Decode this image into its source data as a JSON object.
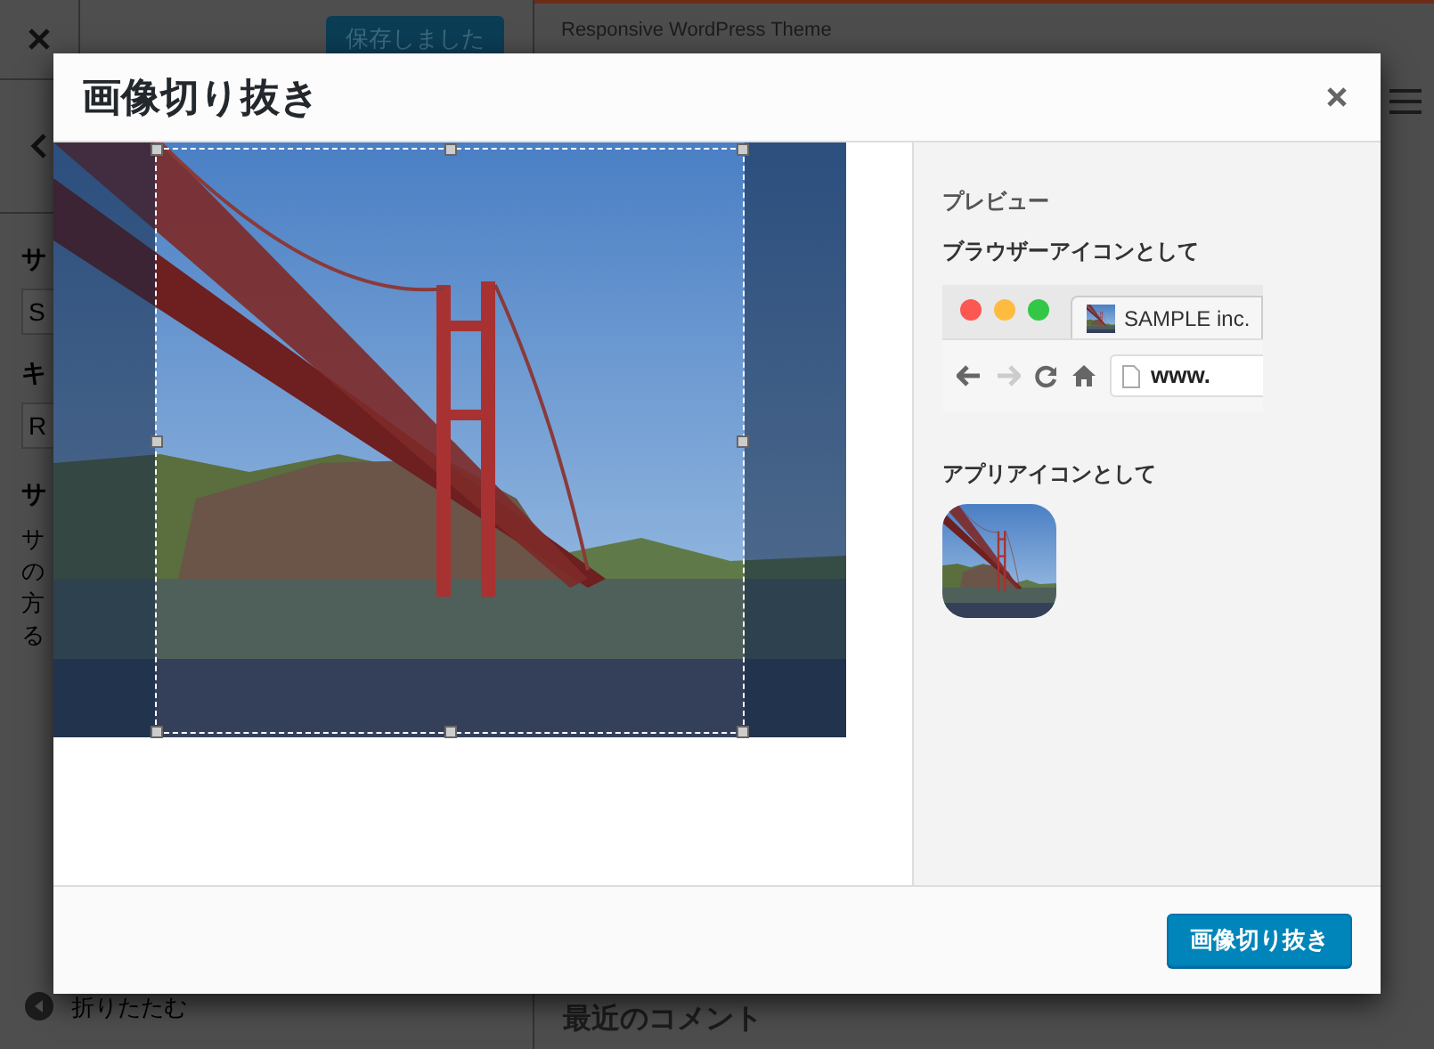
{
  "sidebar": {
    "save_button": "保存しました",
    "fields": [
      {
        "label": "サ",
        "value": "S"
      },
      {
        "label": "キ",
        "value": "R"
      }
    ],
    "section_title": "サ",
    "description_lines": [
      "サ",
      "の",
      "方",
      "る"
    ],
    "collapse": "折りたたむ"
  },
  "site_preview": {
    "site_title": "Responsive WordPress Theme",
    "widget_title": "最近のコメント"
  },
  "modal": {
    "title": "画像切り抜き",
    "preview": {
      "heading": "プレビュー",
      "browser_label": "ブラウザーアイコンとして",
      "browser_tab": "SAMPLE inc.",
      "address": "www.",
      "app_label": "アプリアイコンとして"
    },
    "crop_button": "画像切り抜き"
  }
}
